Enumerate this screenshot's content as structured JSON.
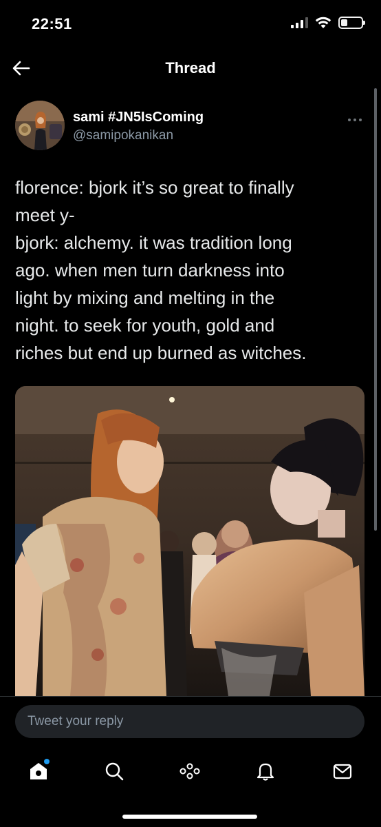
{
  "status_bar": {
    "time": "22:51"
  },
  "header": {
    "title": "Thread"
  },
  "tweet": {
    "display_name": "sami #JN5IsComing",
    "handle": "@samipokanikan",
    "text_lines": [
      "florence: bjork it’s so great to finally",
      "meet y-",
      "bjork: alchemy. it was tradition long",
      "ago. when men turn darkness into",
      "light by mixing and melting in the",
      "night. to seek for youth, gold and",
      "riches but end up burned as witches."
    ]
  },
  "reply": {
    "placeholder": "Tweet your reply"
  },
  "tab_bar": {
    "icons": [
      "home-icon",
      "search-icon",
      "spaces-icon",
      "notifications-icon",
      "messages-icon"
    ],
    "home_has_notification": true
  },
  "colors": {
    "accent": "#1d9bf0",
    "background": "#000000",
    "secondary_text": "#8b98a5"
  }
}
